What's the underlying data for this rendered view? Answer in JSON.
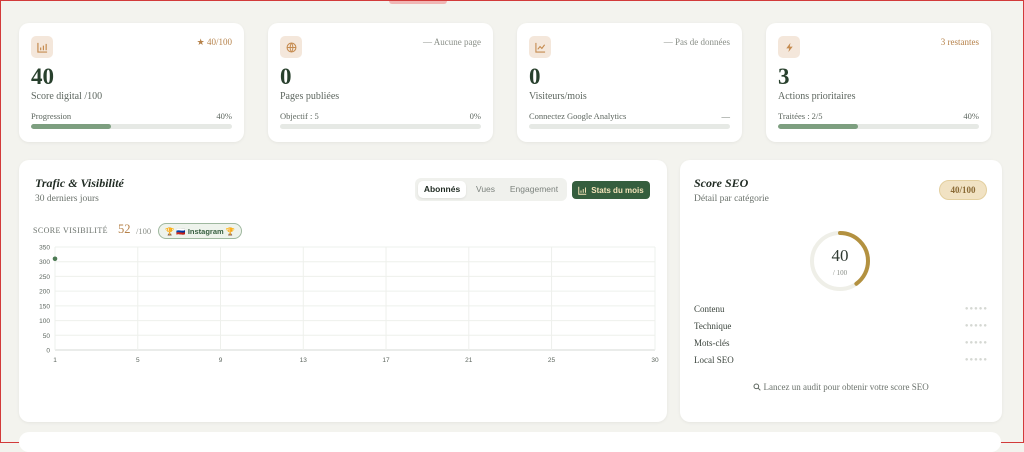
{
  "stats": [
    {
      "icon": "bar-chart-icon",
      "corner": "★ 40/100",
      "value": "40",
      "label": "Score digital /100",
      "sub": "Progression",
      "pct": "40%",
      "progress": 0.4
    },
    {
      "icon": "globe-icon",
      "corner": "— Aucune page",
      "value": "0",
      "label": "Pages publiées",
      "sub": "Objectif : 5",
      "pct": "0%",
      "progress": 0
    },
    {
      "icon": "trend-up-icon",
      "corner": "— Pas de données",
      "value": "0",
      "label": "Visiteurs/mois",
      "sub": "Connectez Google Analytics",
      "pct": "—",
      "progress": 0
    },
    {
      "icon": "lightning-icon",
      "corner": "3 restantes",
      "value": "3",
      "label": "Actions prioritaires",
      "sub": "Traitées : 2/5",
      "pct": "40%",
      "progress": 0.4
    }
  ],
  "traffic": {
    "title": "Trafic & Visibilité",
    "subtitle": "30 derniers jours",
    "tabs": [
      "Abonnés",
      "Vues",
      "Engagement"
    ],
    "active_tab": "Abonnés",
    "month_button": "Stats du mois",
    "visibility_label": "Score visibilité",
    "visibility_value": "52",
    "visibility_max": "/100",
    "badge_text": "🏆 🇷🇺 Instagram 🏆"
  },
  "chart_data": {
    "type": "line",
    "x_ticks": [
      1,
      5,
      9,
      13,
      17,
      21,
      25,
      30
    ],
    "y_ticks": [
      0,
      50,
      100,
      150,
      200,
      250,
      300,
      350
    ],
    "xlim": [
      1,
      30
    ],
    "ylim": [
      0,
      350
    ],
    "series": [
      {
        "x": [
          1
        ],
        "y": [
          310
        ]
      }
    ],
    "grid": true,
    "series_color": "#4e7b55"
  },
  "seo": {
    "title": "Score SEO",
    "subtitle": "Détail par catégorie",
    "badge": "40/100",
    "score": "40",
    "score_max": "/ 100",
    "score_fraction": 0.4,
    "categories": [
      "Contenu",
      "Technique",
      "Mots-clés",
      "Local SEO"
    ],
    "dots": "●●●●●",
    "audit_text": "Lancez un audit pour obtenir votre score SEO"
  },
  "colors": {
    "accent_green": "#355e3e",
    "gold": "#b6824a",
    "progress": "#7d9f80"
  }
}
